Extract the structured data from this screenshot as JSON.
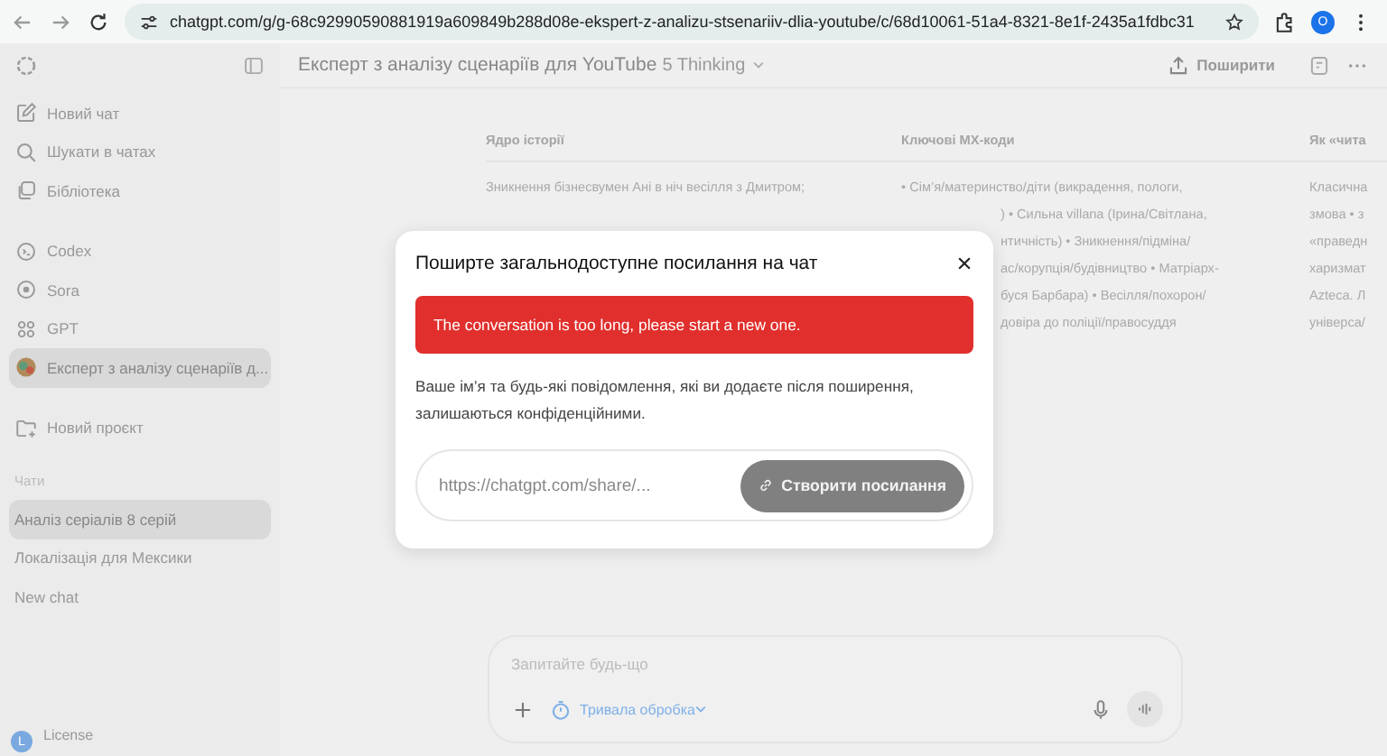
{
  "browser": {
    "url": "chatgpt.com/g/g-68c92990590881919a609849b288d08e-ekspert-z-analizu-stsenariiv-dlia-youtube/c/68d10061-51a4-8321-8e1f-2435a1fdbc31",
    "profile_initial": "O"
  },
  "sidebar": {
    "nav": [
      {
        "label": "Новий чат"
      },
      {
        "label": "Шукати в чатах"
      },
      {
        "label": "Бібліотека"
      }
    ],
    "tools": [
      {
        "label": "Codex"
      },
      {
        "label": "Sora"
      },
      {
        "label": "GPT"
      }
    ],
    "gpts": [
      {
        "label": "Експерт з аналізу сценаріїв д...",
        "selected": true
      }
    ],
    "projects": [
      {
        "label": "Новий проєкт"
      }
    ],
    "chats_heading": "Чати",
    "chats": [
      {
        "label": "Аналіз серіалів 8 серій",
        "selected": true
      },
      {
        "label": "Локалізація для Мексики",
        "selected": false
      },
      {
        "label": "New chat",
        "selected": false
      }
    ],
    "account": {
      "initial": "L",
      "name": "License"
    }
  },
  "header": {
    "title": "Експерт з аналізу сценаріїв для YouTube",
    "model": "5 Thinking",
    "share": "Поширити"
  },
  "table": {
    "columns": [
      "Ядро історії",
      "Ключові МХ-коди",
      "Як «чита"
    ],
    "rows": [
      [
        [
          "Зникнення бізнесвумен Ані в ніч весілля з Дмитром;"
        ],
        [
          "• Сім’я/материнство/діти (викрадення, пологи,",
          ") • Сильна villana (Ірина/Світлана,",
          "нтичність) • Зникнення/підміна/",
          "ас/корупція/будівництво • Матріарх-",
          "буся Барбара) • Весілля/похорон/",
          "довіра до поліції/правосуддя"
        ],
        [
          "Класична",
          "змова • з",
          "«праведн",
          "харизмат",
          "Azteca. Л",
          "універса/"
        ]
      ]
    ]
  },
  "dialog": {
    "title": "Поширте загальнодоступне посилання на чат",
    "error": "The conversation is too long, please start a new one.",
    "note": "Ваше ім’я та будь-які повідомлення, які ви додаєте після поширення, залишаються конфіденційними.",
    "link_placeholder": "https://chatgpt.com/share/...",
    "create_button": {
      "label": "Створити посилання",
      "disabled": true
    }
  },
  "composer": {
    "placeholder": "Запитайте будь-що",
    "mode": "Тривала обробка"
  }
}
